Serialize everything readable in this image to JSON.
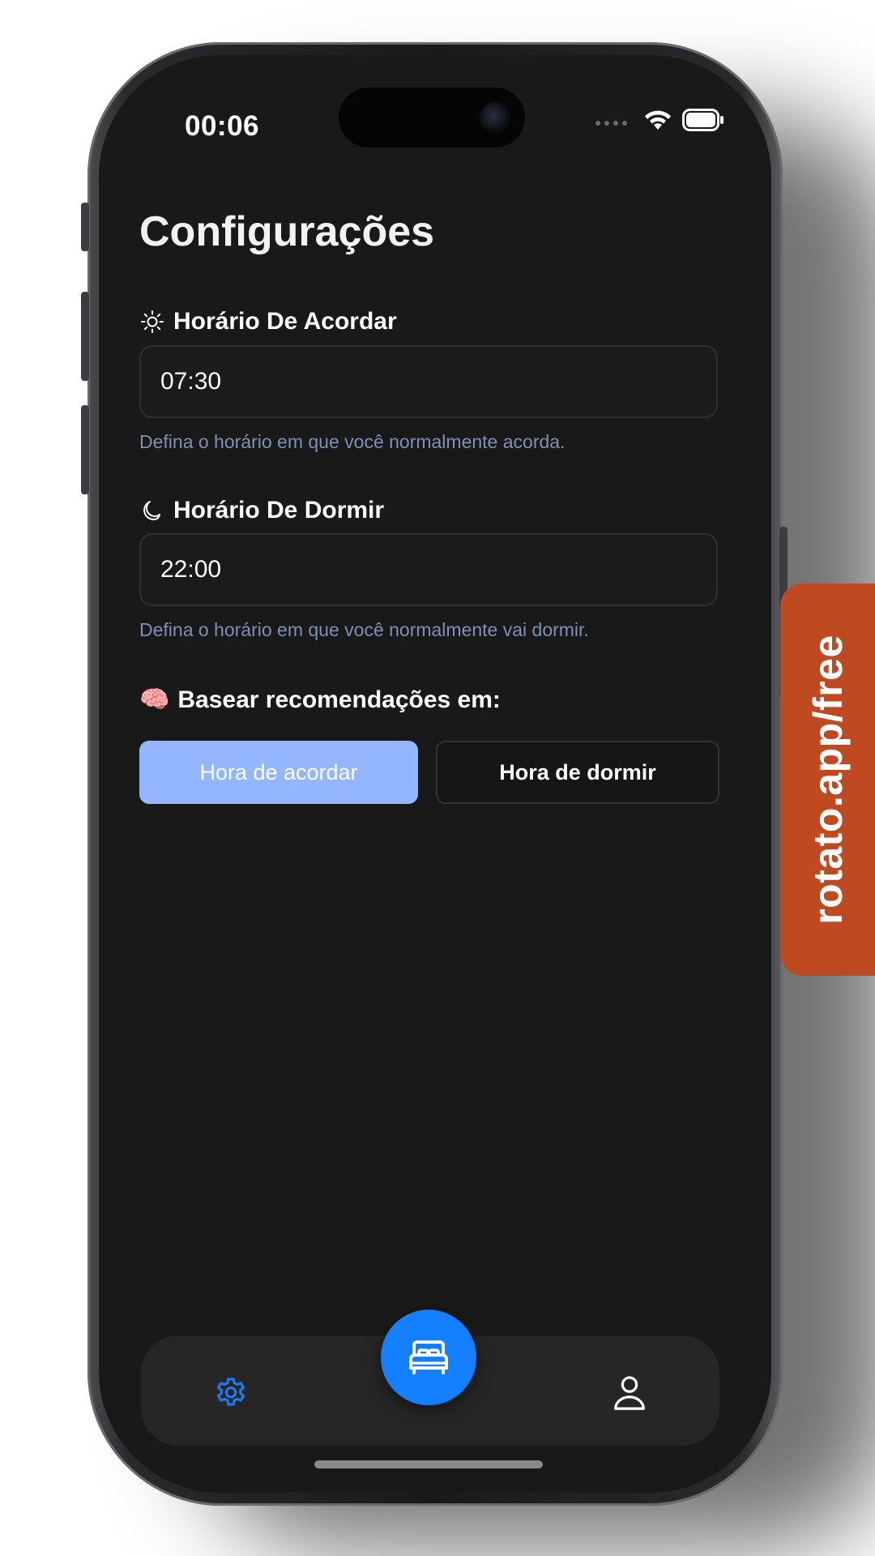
{
  "status_bar": {
    "time": "00:06",
    "icons": [
      "signal-dots-icon",
      "wifi-icon",
      "battery-icon"
    ]
  },
  "page": {
    "title": "Configurações"
  },
  "wake": {
    "icon": "sun-icon",
    "label": "Horário De Acordar",
    "value": "07:30",
    "hint": "Defina o horário em que você normalmente acorda."
  },
  "sleep": {
    "icon": "moon-icon",
    "label": "Horário De Dormir",
    "value": "22:00",
    "hint": "Defina o horário em que você normalmente vai dormir."
  },
  "basis": {
    "emoji": "🧠",
    "label": "Basear recomendações em:",
    "options": [
      {
        "label": "Hora de acordar",
        "selected": true
      },
      {
        "label": "Hora de dormir",
        "selected": false
      }
    ]
  },
  "tab_bar": {
    "items": [
      {
        "icon": "gear-icon",
        "active": true
      },
      {
        "icon": "bed-icon",
        "active": false
      },
      {
        "icon": "person-icon",
        "active": false
      }
    ]
  },
  "colors": {
    "background": "#191919",
    "accent": "#1480ff",
    "selected_option": "#94b6ff",
    "hint_text": "#7f8fb5",
    "watermark": "#bf4a22"
  },
  "watermark": {
    "text": "rotato.app/free"
  }
}
